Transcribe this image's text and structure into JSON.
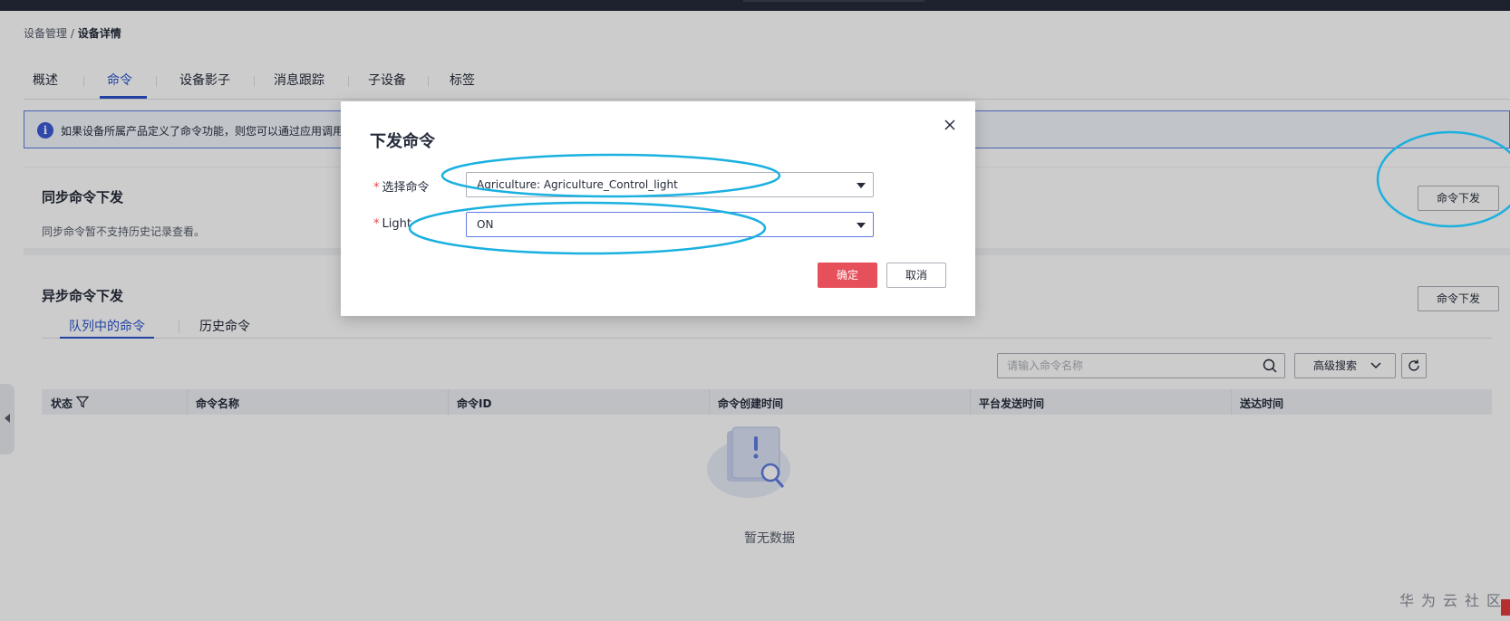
{
  "breadcrumb": {
    "parent": "设备管理 /",
    "current": "设备详情"
  },
  "tabs": [
    {
      "label": "概述"
    },
    {
      "label": "命令",
      "active": true
    },
    {
      "label": "设备影子"
    },
    {
      "label": "消息跟踪"
    },
    {
      "label": "子设备"
    },
    {
      "label": "标签"
    }
  ],
  "notice": {
    "text": "如果设备所属产品定义了命令功能，则您可以通过应用调用"
  },
  "sync_section": {
    "title": "同步命令下发",
    "description": "同步命令暂不支持历史记录查看。",
    "button": "命令下发"
  },
  "async_section": {
    "title": "异步命令下发",
    "button": "命令下发",
    "subtabs": [
      {
        "label": "队列中的命令",
        "active": true
      },
      {
        "label": "历史命令"
      }
    ],
    "search": {
      "placeholder": "请输入命令名称",
      "icon": "search-icon"
    },
    "advanced_search": "高级搜索",
    "columns": [
      "状态",
      "命令名称",
      "命令ID",
      "命令创建时间",
      "平台发送时间",
      "送达时间"
    ],
    "empty_text": "暂无数据"
  },
  "modal": {
    "title": "下发命令",
    "fields": [
      {
        "label": "选择命令",
        "value": "Agriculture: Agriculture_Control_light"
      },
      {
        "label": "Light",
        "value": "ON"
      }
    ],
    "ok_label": "确定",
    "cancel_label": "取消"
  },
  "watermark": "华为云社区",
  "colors": {
    "primary": "#2a53cc",
    "danger": "#e6505a",
    "annotation": "#1ab0e0"
  }
}
